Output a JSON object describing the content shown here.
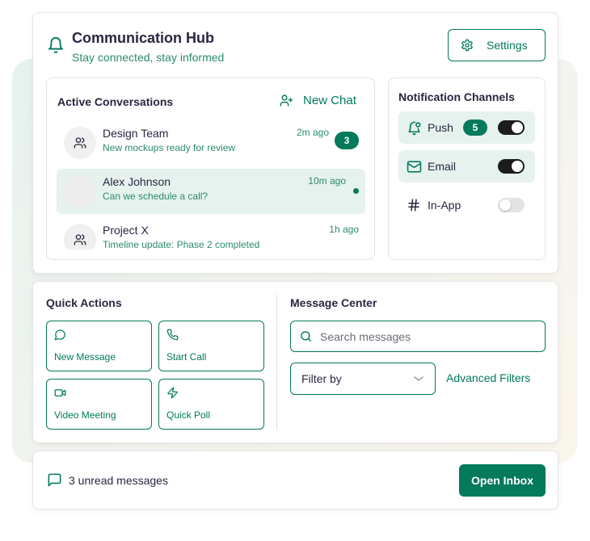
{
  "colors": {
    "accent": "#027a5b",
    "accent_soft": "#e6f2ee",
    "text_primary": "#2a2540",
    "text_secondary": "#2c8a6e",
    "toggle_on": "#1c1c1e",
    "toggle_off": "#e4e4e4"
  },
  "header": {
    "icon": "bell-icon",
    "title": "Communication Hub",
    "subtitle": "Stay connected, stay informed",
    "settings_label": "Settings",
    "settings_icon": "gear-icon"
  },
  "conversations": {
    "title": "Active Conversations",
    "new_chat_label": "New Chat",
    "new_chat_icon": "user-plus-icon",
    "items": [
      {
        "name": "Design Team",
        "message": "New mockups ready for review",
        "time": "2m ago",
        "unread": "3",
        "avatar_icon": "users-icon",
        "active": false
      },
      {
        "name": "Alex Johnson",
        "message": "Can we schedule a call?",
        "time": "10m ago",
        "online": true,
        "avatar_icon": "blank-avatar",
        "active": true
      },
      {
        "name": "Project X",
        "message": "Timeline update: Phase 2 completed",
        "time": "1h ago",
        "avatar_icon": "users-icon",
        "active": false
      }
    ]
  },
  "notifications": {
    "title": "Notification Channels",
    "channels": [
      {
        "label": "Push",
        "icon": "bell-dot-icon",
        "count": "5",
        "enabled": true
      },
      {
        "label": "Email",
        "icon": "mail-icon",
        "enabled": true
      },
      {
        "label": "In-App",
        "icon": "hash-icon",
        "enabled": false
      }
    ]
  },
  "quick_actions": {
    "title": "Quick Actions",
    "items": [
      {
        "label": "New Message",
        "icon": "message-circle-icon"
      },
      {
        "label": "Start Call",
        "icon": "phone-icon"
      },
      {
        "label": "Video Meeting",
        "icon": "video-icon"
      },
      {
        "label": "Quick Poll",
        "icon": "zap-icon"
      }
    ]
  },
  "message_center": {
    "title": "Message Center",
    "search_placeholder": "Search messages",
    "search_value": "",
    "filter_selected": "Filter by",
    "advanced_filters_label": "Advanced Filters"
  },
  "footer": {
    "unread_text": "3 unread messages",
    "open_inbox_label": "Open Inbox"
  }
}
